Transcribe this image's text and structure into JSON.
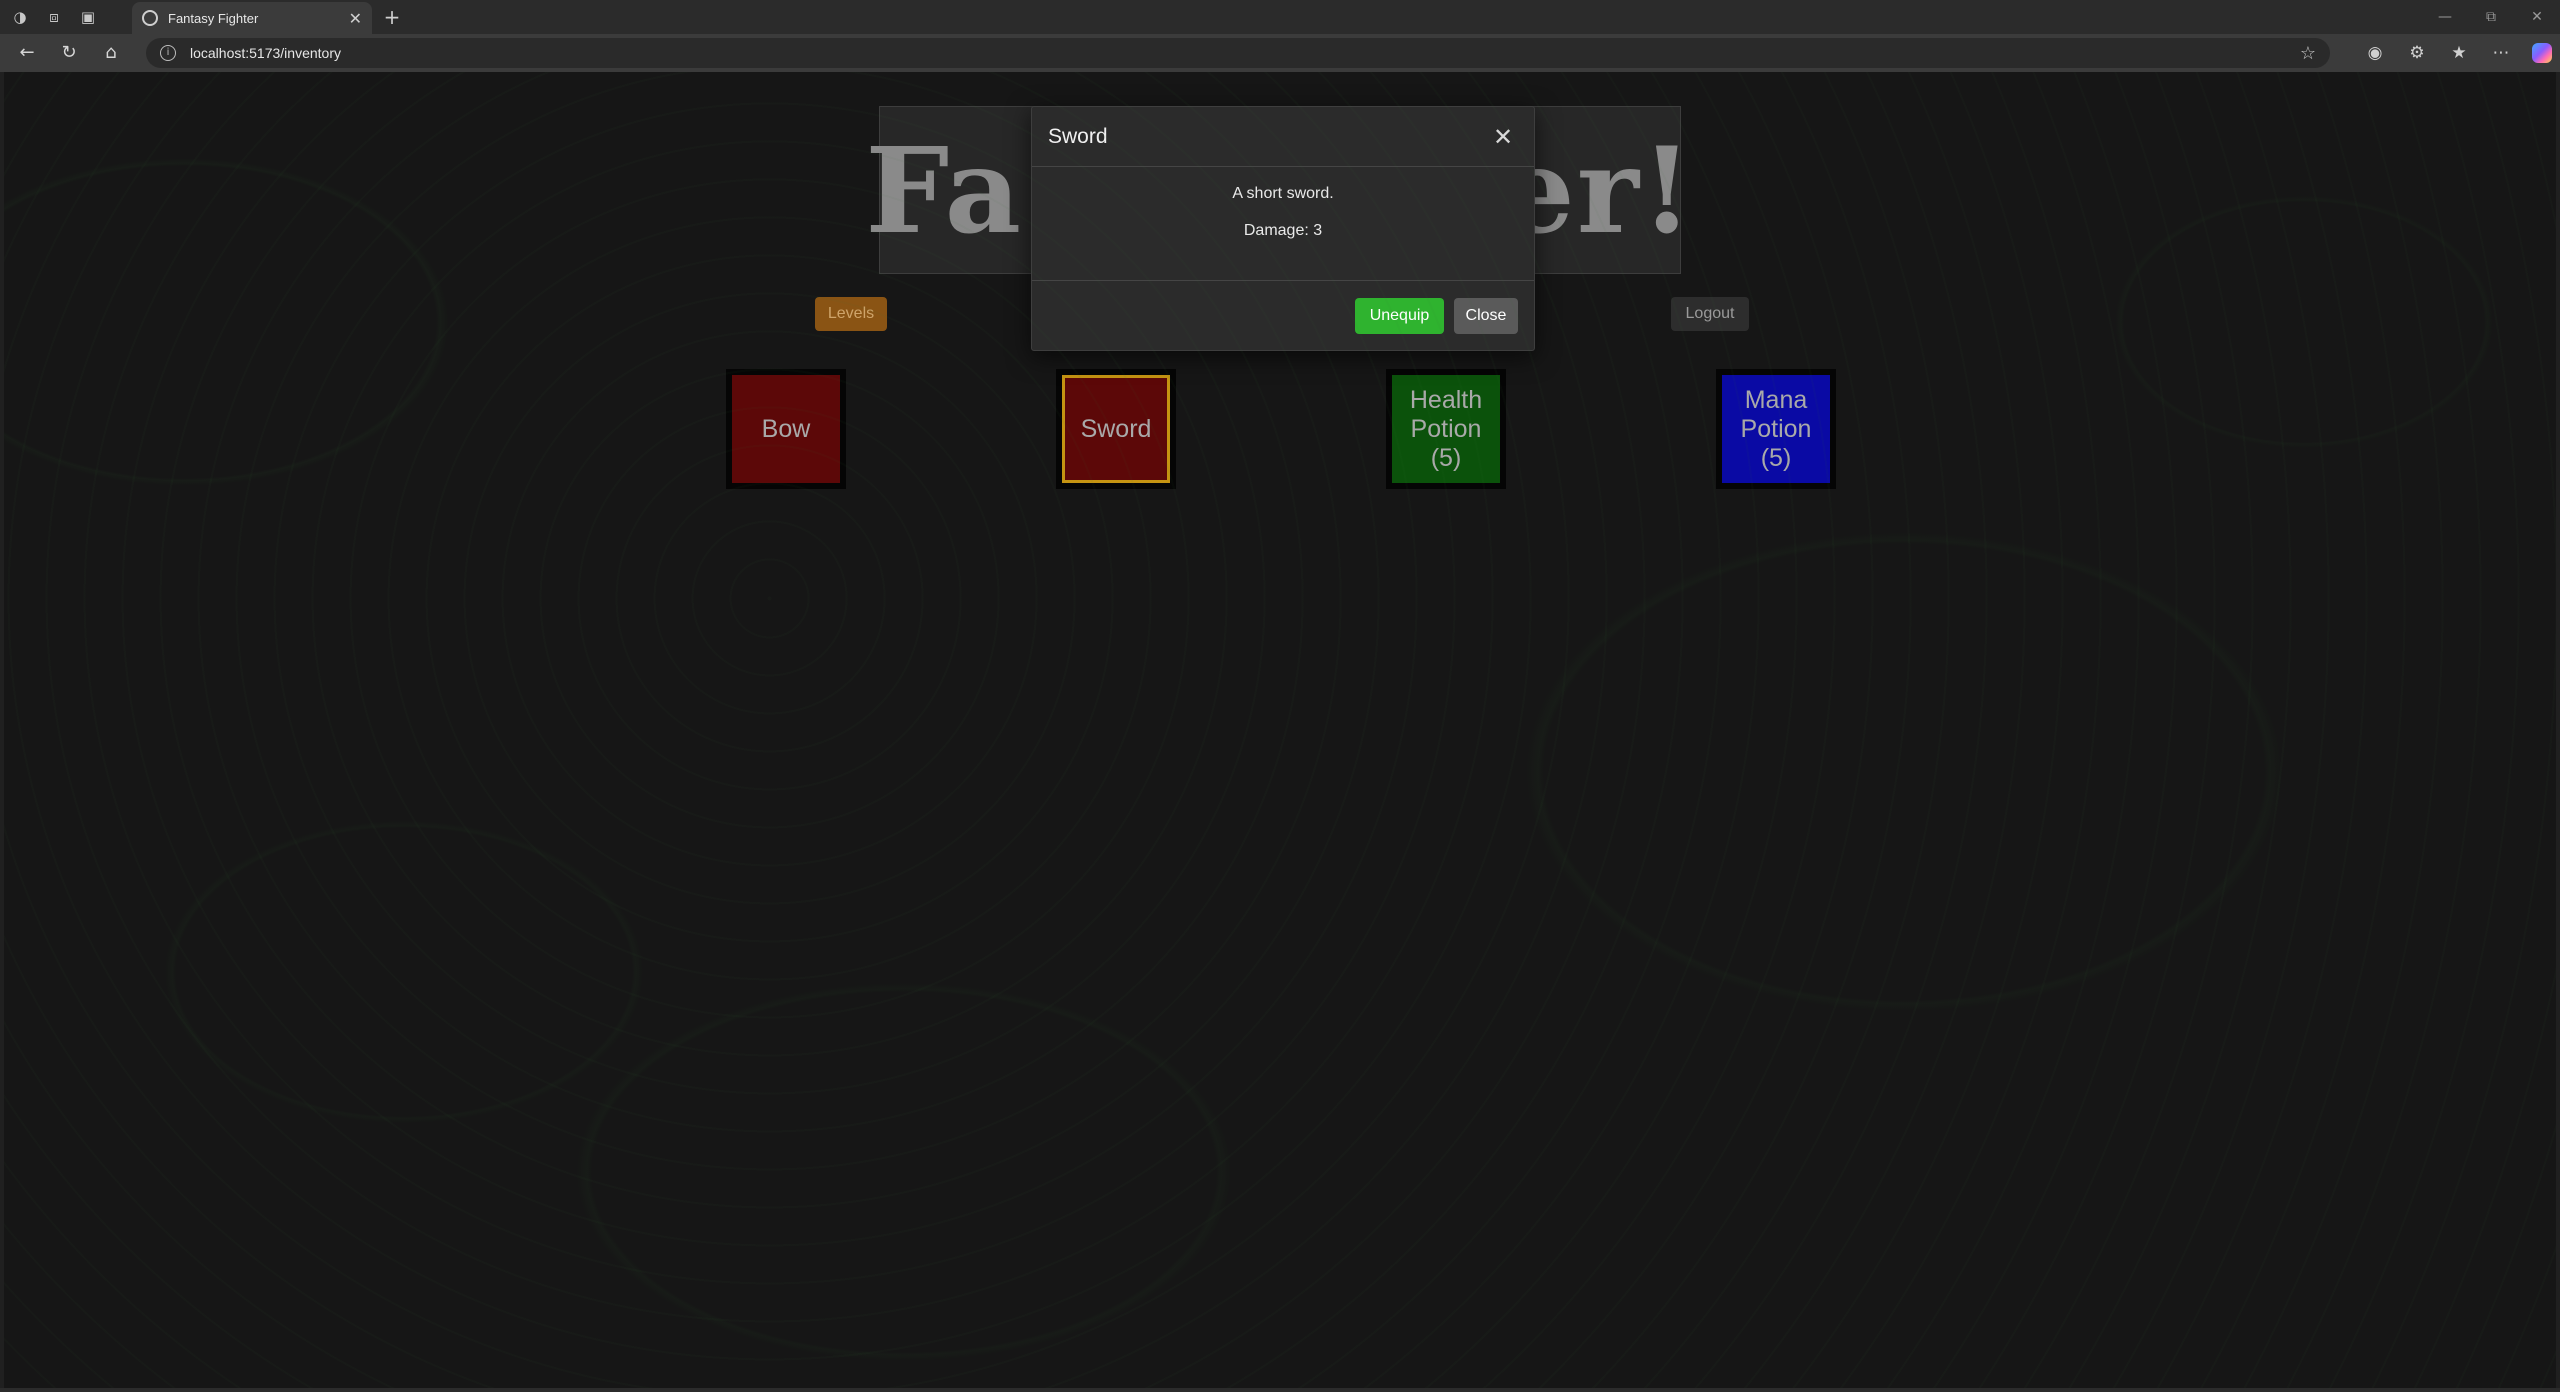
{
  "browser": {
    "tab_title": "Fantasy Fighter",
    "url": "localhost:5173/inventory",
    "icons": [
      "profile-icon",
      "workspaces-icon",
      "tab-actions-icon",
      "back-icon",
      "refresh-icon",
      "home-icon",
      "site-info-icon",
      "favorite-star-icon",
      "reading-mode-icon",
      "extensions-icon",
      "favorites-icon",
      "more-icon",
      "copilot-icon"
    ]
  },
  "page": {
    "title_left": "Fa",
    "title_right": "ter!",
    "levels_label": "Levels",
    "logout_label": "Logout",
    "colors": {
      "levels_bg": "#8a5414",
      "bow_bg": "#5c0808",
      "sword_bg": "#5c0808",
      "sword_border": "#c59412",
      "health_bg": "#0b520b",
      "mana_bg": "#0a0aa4"
    }
  },
  "inventory": {
    "items": [
      {
        "name": "Bow",
        "count": ""
      },
      {
        "name": "Sword",
        "count": "",
        "equipped": true
      },
      {
        "name": "Health Potion",
        "count": "(5)"
      },
      {
        "name": "Mana Potion",
        "count": "(5)"
      }
    ]
  },
  "modal": {
    "title": "Sword",
    "description": "A short sword.",
    "stat": "Damage: 3",
    "unequip_label": "Unequip",
    "close_label": "Close",
    "colors": {
      "unequip_bg": "#2fb32f",
      "close_bg": "#5a5a5a"
    }
  }
}
